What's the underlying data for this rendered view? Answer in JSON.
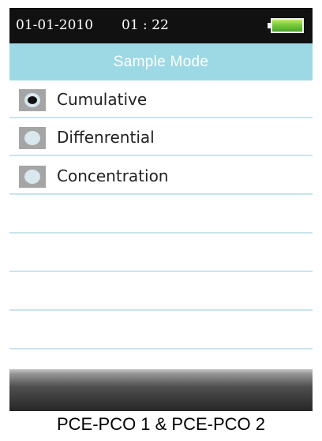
{
  "status_bar": {
    "date": "01-01-2010",
    "time": "01 : 22",
    "battery_icon": "battery-full-icon"
  },
  "header": {
    "title": "Sample Mode",
    "background_color": "#9dd9e4",
    "text_color": "#ffffff"
  },
  "menu": {
    "selected_option": "Cumulative",
    "options": [
      {
        "label": "Cumulative",
        "selected": true,
        "icon": "radio-selected-icon"
      },
      {
        "label": "Diffenrential",
        "selected": false,
        "icon": "radio-unselected-icon"
      },
      {
        "label": "Concentration",
        "selected": false,
        "icon": "radio-unselected-icon"
      }
    ],
    "separator_color": "#c8e5ec"
  },
  "footer": {
    "caption": "PCE-PCO 1 & PCE-PCO 2"
  }
}
